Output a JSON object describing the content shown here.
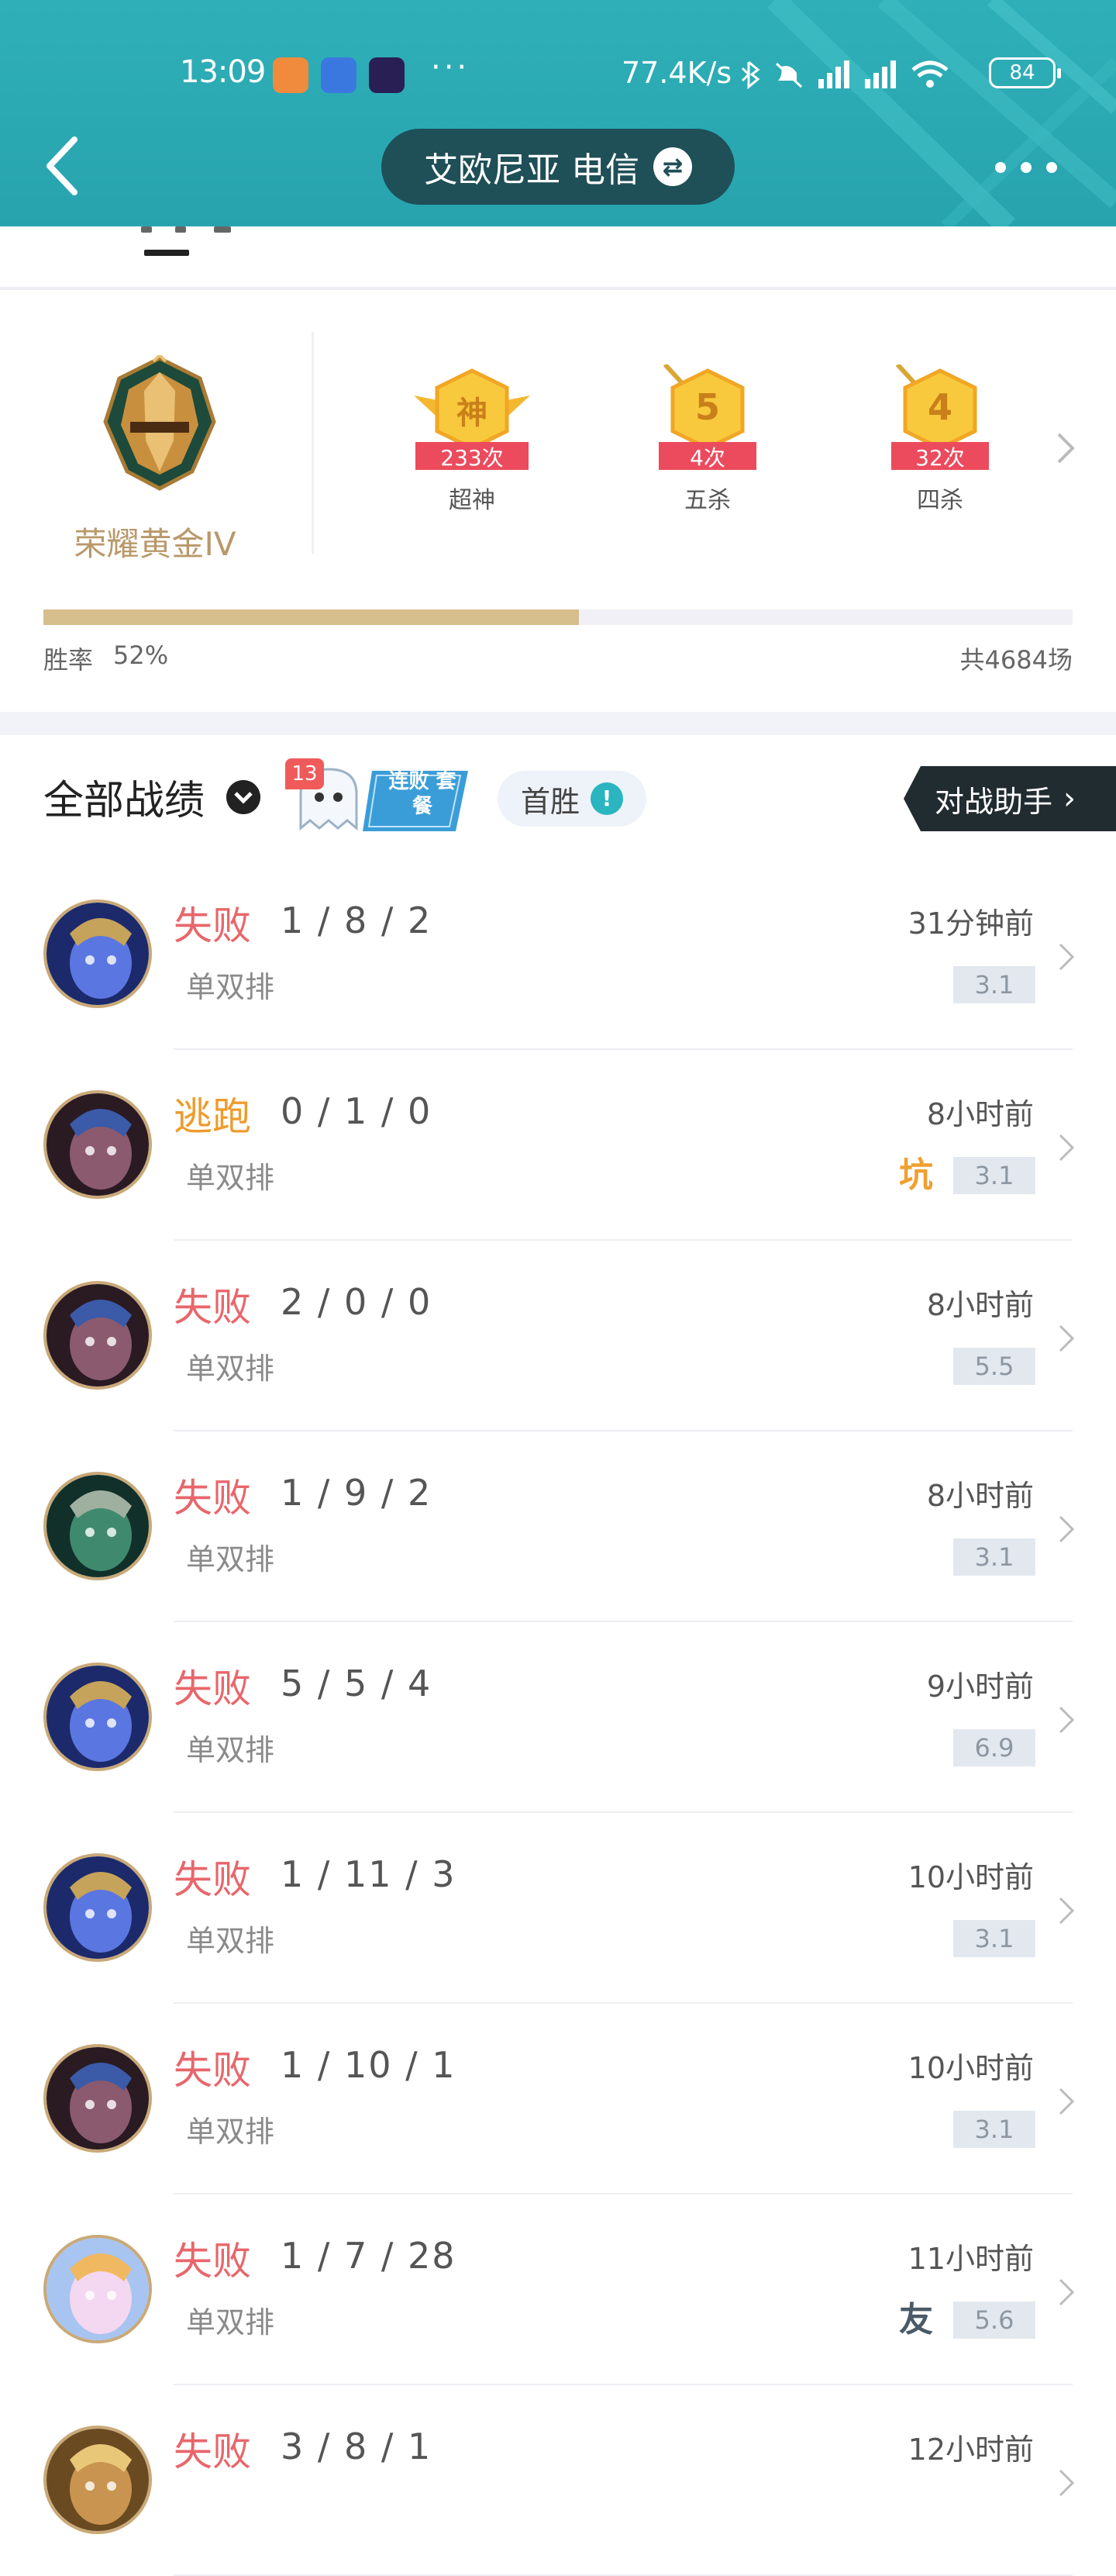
{
  "status_bar": {
    "time": "13:09",
    "dots": "···",
    "network_speed": "77.4K/s",
    "battery": "84"
  },
  "header": {
    "server": "艾欧尼亚 电信",
    "swap_icon": "swap-icon",
    "back_icon": "back-arrow-icon",
    "more_icon": "more-dots-icon"
  },
  "rank": {
    "name": "荣耀黄金IV",
    "badges": [
      {
        "glyph": "神",
        "count": "233次",
        "label": "超神"
      },
      {
        "glyph": "5",
        "count": "4次",
        "label": "五杀"
      },
      {
        "glyph": "4",
        "count": "32次",
        "label": "四杀"
      }
    ],
    "win_rate_label": "胜率",
    "win_rate_value": "52%",
    "win_rate_fraction": 0.52,
    "total_games": "共4684场"
  },
  "filter": {
    "title": "全部战绩",
    "streak_count": "13",
    "streak_text": "连败 套餐",
    "first_win": "首胜",
    "first_win_icon": "!",
    "assistant": "对战助手"
  },
  "matches": [
    {
      "result": "失败",
      "kda": "1 / 8 / 2",
      "queue": "单双排",
      "time": "31分钟前",
      "score": "3.1",
      "tag": "",
      "champion": "blue-dragon"
    },
    {
      "result": "逃跑",
      "kda": "0 / 1 / 0",
      "queue": "单双排",
      "time": "8小时前",
      "score": "3.1",
      "tag": "坑",
      "champion": "dark-swordsman"
    },
    {
      "result": "失败",
      "kda": "2 / 0 / 0",
      "queue": "单双排",
      "time": "8小时前",
      "score": "5.5",
      "tag": "",
      "champion": "dark-swordsman"
    },
    {
      "result": "失败",
      "kda": "1 / 9 / 2",
      "queue": "单双排",
      "time": "8小时前",
      "score": "3.1",
      "tag": "",
      "champion": "green-armor"
    },
    {
      "result": "失败",
      "kda": "5 / 5 / 4",
      "queue": "单双排",
      "time": "9小时前",
      "score": "6.9",
      "tag": "",
      "champion": "blue-dragon"
    },
    {
      "result": "失败",
      "kda": "1 / 11 / 3",
      "queue": "单双排",
      "time": "10小时前",
      "score": "3.1",
      "tag": "",
      "champion": "blue-dragon"
    },
    {
      "result": "失败",
      "kda": "1 / 10 / 1",
      "queue": "单双排",
      "time": "10小时前",
      "score": "3.1",
      "tag": "",
      "champion": "dark-swordsman"
    },
    {
      "result": "失败",
      "kda": "1 / 7 / 28",
      "queue": "单双排",
      "time": "11小时前",
      "score": "5.6",
      "tag": "友",
      "champion": "cat"
    },
    {
      "result": "失败",
      "kda": "3 / 8 / 1",
      "queue": "",
      "time": "12小时前",
      "score": "",
      "tag": "",
      "champion": "monkey"
    }
  ],
  "colors": {
    "header_bg": "#2fb0b8",
    "loss": "#e8666b",
    "escape": "#ef9b2b",
    "rank_gold": "#b9986a",
    "progress_fill": "#d6bf8c"
  }
}
